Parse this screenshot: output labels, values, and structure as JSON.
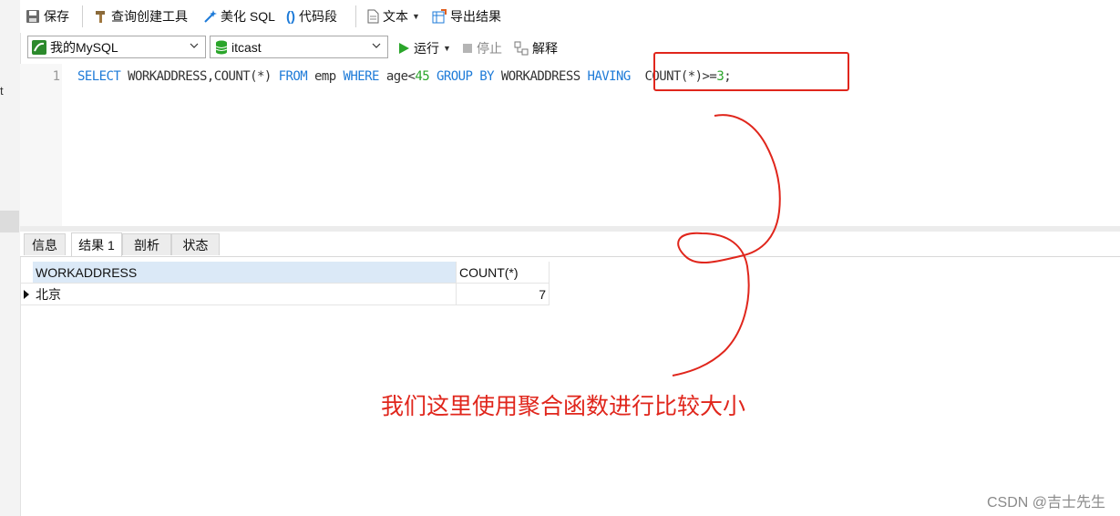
{
  "toolbar": {
    "save": "保存",
    "query_builder": "查询创建工具",
    "beautify_sql": "美化 SQL",
    "code_snippet": "代码段",
    "text": "文本",
    "export": "导出结果"
  },
  "toolbar2": {
    "connection": "我的MySQL",
    "database": "itcast",
    "run": "运行",
    "stop": "停止",
    "explain": "解释"
  },
  "left_strip": {
    "text": "t"
  },
  "editor": {
    "line_number": "1",
    "tokens": {
      "select": "SELECT",
      "col_list": " WORKADDRESS,COUNT(*) ",
      "from": "FROM",
      "table": " emp ",
      "where": "WHERE",
      "cond": " age<",
      "num45": "45",
      "sp": " ",
      "group_by": "GROUP BY",
      "group_col": " WORKADDRESS ",
      "having": "HAVING",
      "having_expr": "  COUNT(*)>=",
      "num3": "3",
      "end": ";"
    }
  },
  "tabs": [
    {
      "label": "信息"
    },
    {
      "label": "结果 1"
    },
    {
      "label": "剖析"
    },
    {
      "label": "状态"
    }
  ],
  "result": {
    "columns": [
      "WORKADDRESS",
      "COUNT(*)"
    ],
    "rows": [
      {
        "workaddress": "北京",
        "count": "7"
      }
    ]
  },
  "annotation": {
    "text": "我们这里使用聚合函数进行比较大小",
    "color": "#e0261c"
  },
  "watermark": "CSDN @吉士先生",
  "colors": {
    "keyword": "#1e7bd8",
    "number": "#2aa52a",
    "header_selected": "#dbe9f7",
    "run_green": "#2aa52a"
  }
}
